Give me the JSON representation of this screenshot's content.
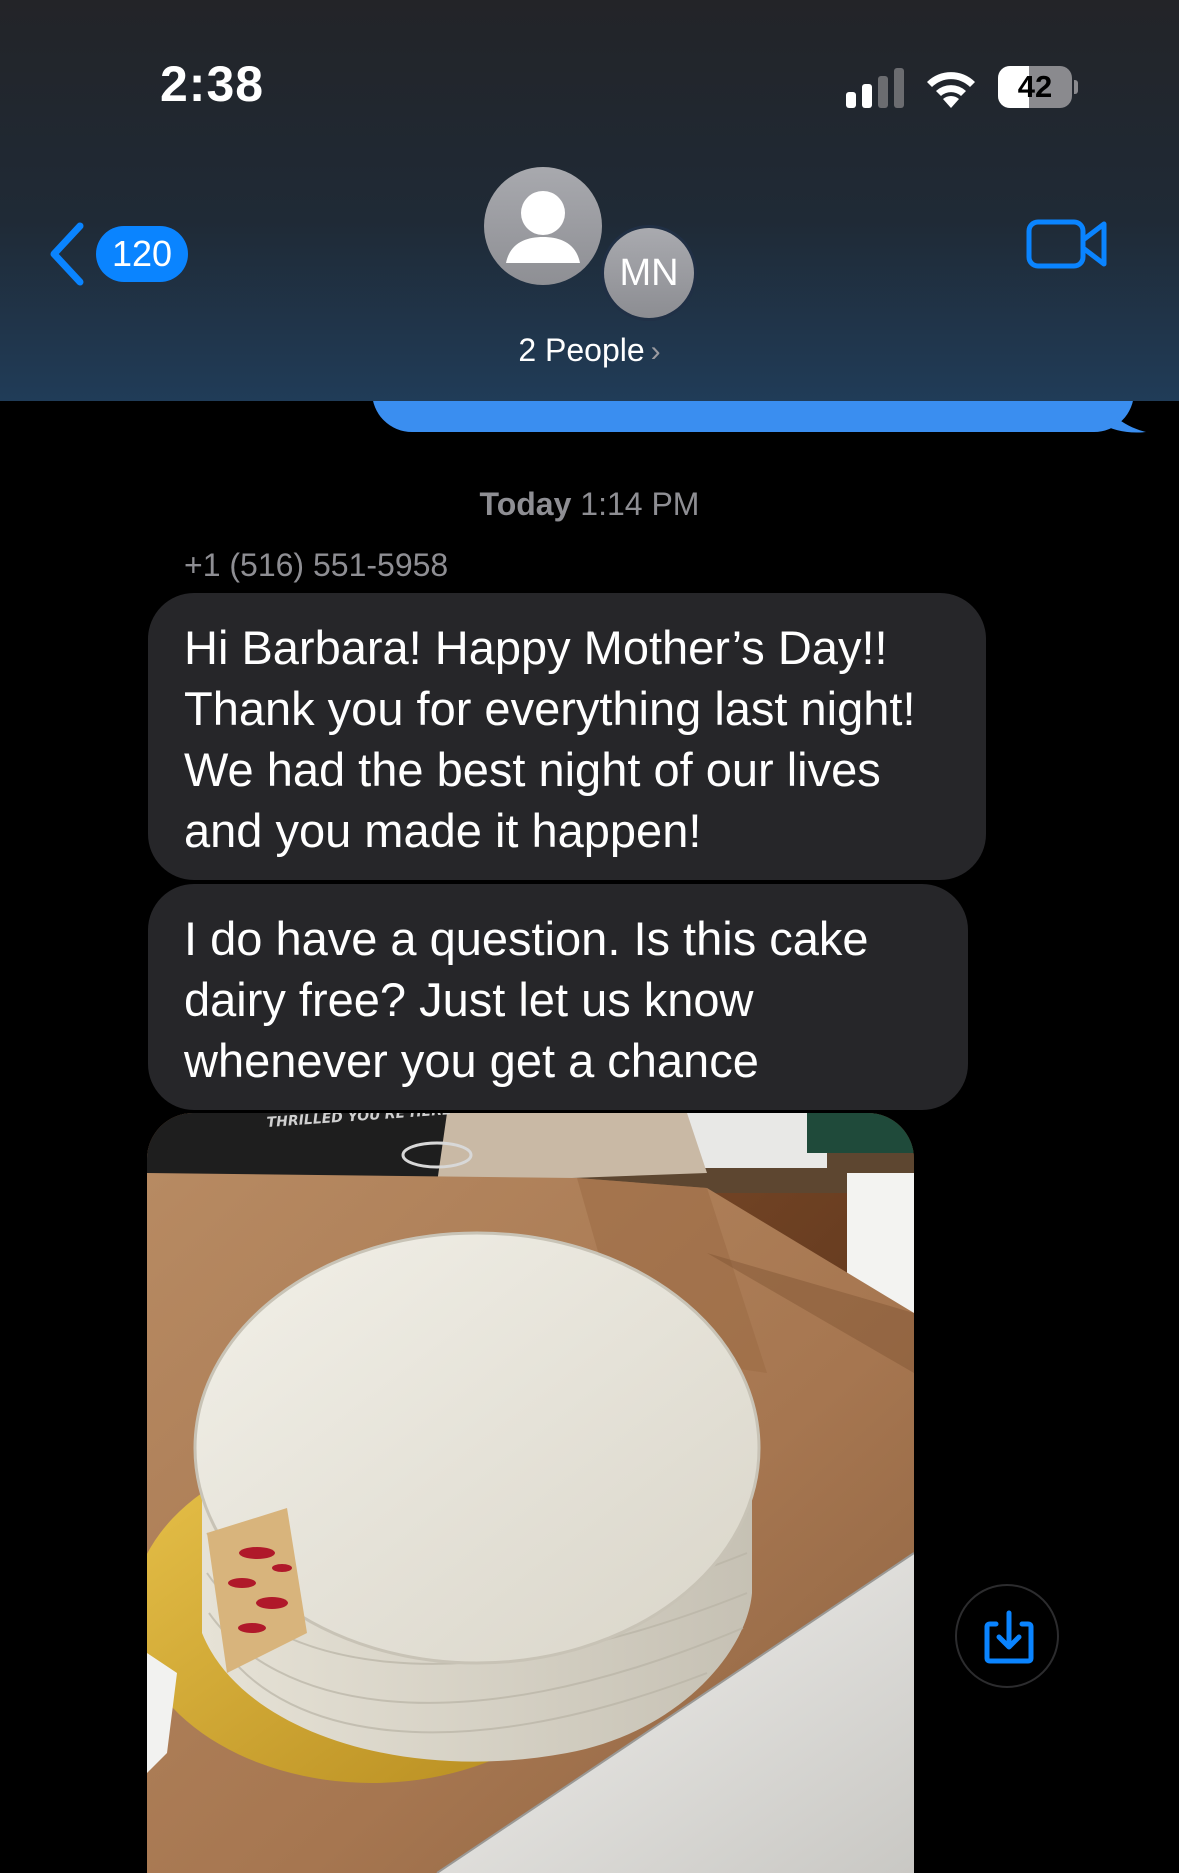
{
  "status_bar": {
    "time": "2:38",
    "battery_percent": "42",
    "battery_level": 0.42,
    "signal_bars": 2
  },
  "header": {
    "back_count": "120",
    "avatar_initials": "MN",
    "group_title": "2 People",
    "icons": [
      "back-chevron-icon",
      "person-icon",
      "chevron-right-icon",
      "video-camera-icon",
      "wifi-icon",
      "battery-icon"
    ]
  },
  "thread": {
    "timestamp_day": "Today",
    "timestamp_time": "1:14 PM",
    "sender": "+1 (516) 551-5958",
    "messages": [
      {
        "text": "Hi Barbara! Happy Mother’s Day!! Thank you for everything last night! We had the best night of our lives and you made it happen!"
      },
      {
        "text": "I do have a question. Is this cake dairy free? Just let us know whenever you get a chance"
      }
    ],
    "photo_overlay_text": "THRILLED YOU'RE HERE"
  },
  "colors": {
    "accent_blue": "#0a84ff",
    "sent_bubble": "#3a8ef0",
    "received_bubble": "#262629",
    "secondary_text": "#8e8e93"
  }
}
